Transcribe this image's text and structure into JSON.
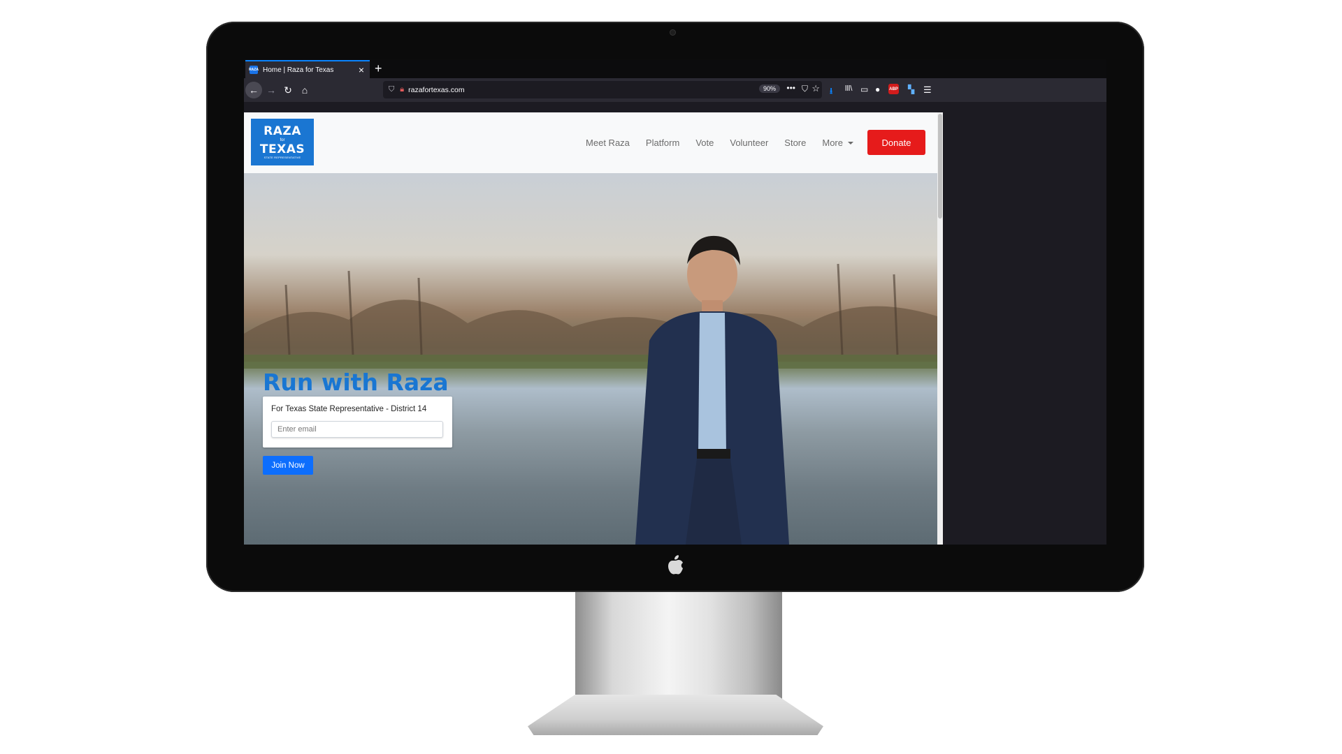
{
  "browser": {
    "tab_title": "Home | Raza for Texas",
    "tab_favicon_text": "RAZA",
    "url": "razafortexas.com",
    "zoom": "90%",
    "abp_label": "ABP"
  },
  "site": {
    "logo": {
      "line1": "RAZA",
      "line2": "for",
      "line3": "TEXAS",
      "line4": "STATE REPRESENTATIVE"
    },
    "nav": {
      "items": [
        "Meet Raza",
        "Platform",
        "Vote",
        "Volunteer",
        "Store",
        "More"
      ],
      "donate": "Donate"
    },
    "hero": {
      "title": "Run with Raza",
      "subtitle": "For Texas State Representative - District 14",
      "email_placeholder": "Enter email",
      "join_button": "Join Now"
    }
  },
  "colors": {
    "brand_blue": "#1a76d2",
    "donate_red": "#e61b1b",
    "join_blue": "#0d6efd",
    "browser_accent": "#0a84ff"
  },
  "icons": [
    "back-arrow-icon",
    "forward-arrow-icon",
    "reload-icon",
    "home-icon",
    "shield-icon",
    "site-lock-icon",
    "more-dots-icon",
    "pocket-icon",
    "bookmark-star-icon",
    "download-icon",
    "library-icon",
    "sidebar-icon",
    "account-icon",
    "adblock-icon",
    "extension-icon",
    "hamburger-menu-icon",
    "apple-logo-icon"
  ]
}
